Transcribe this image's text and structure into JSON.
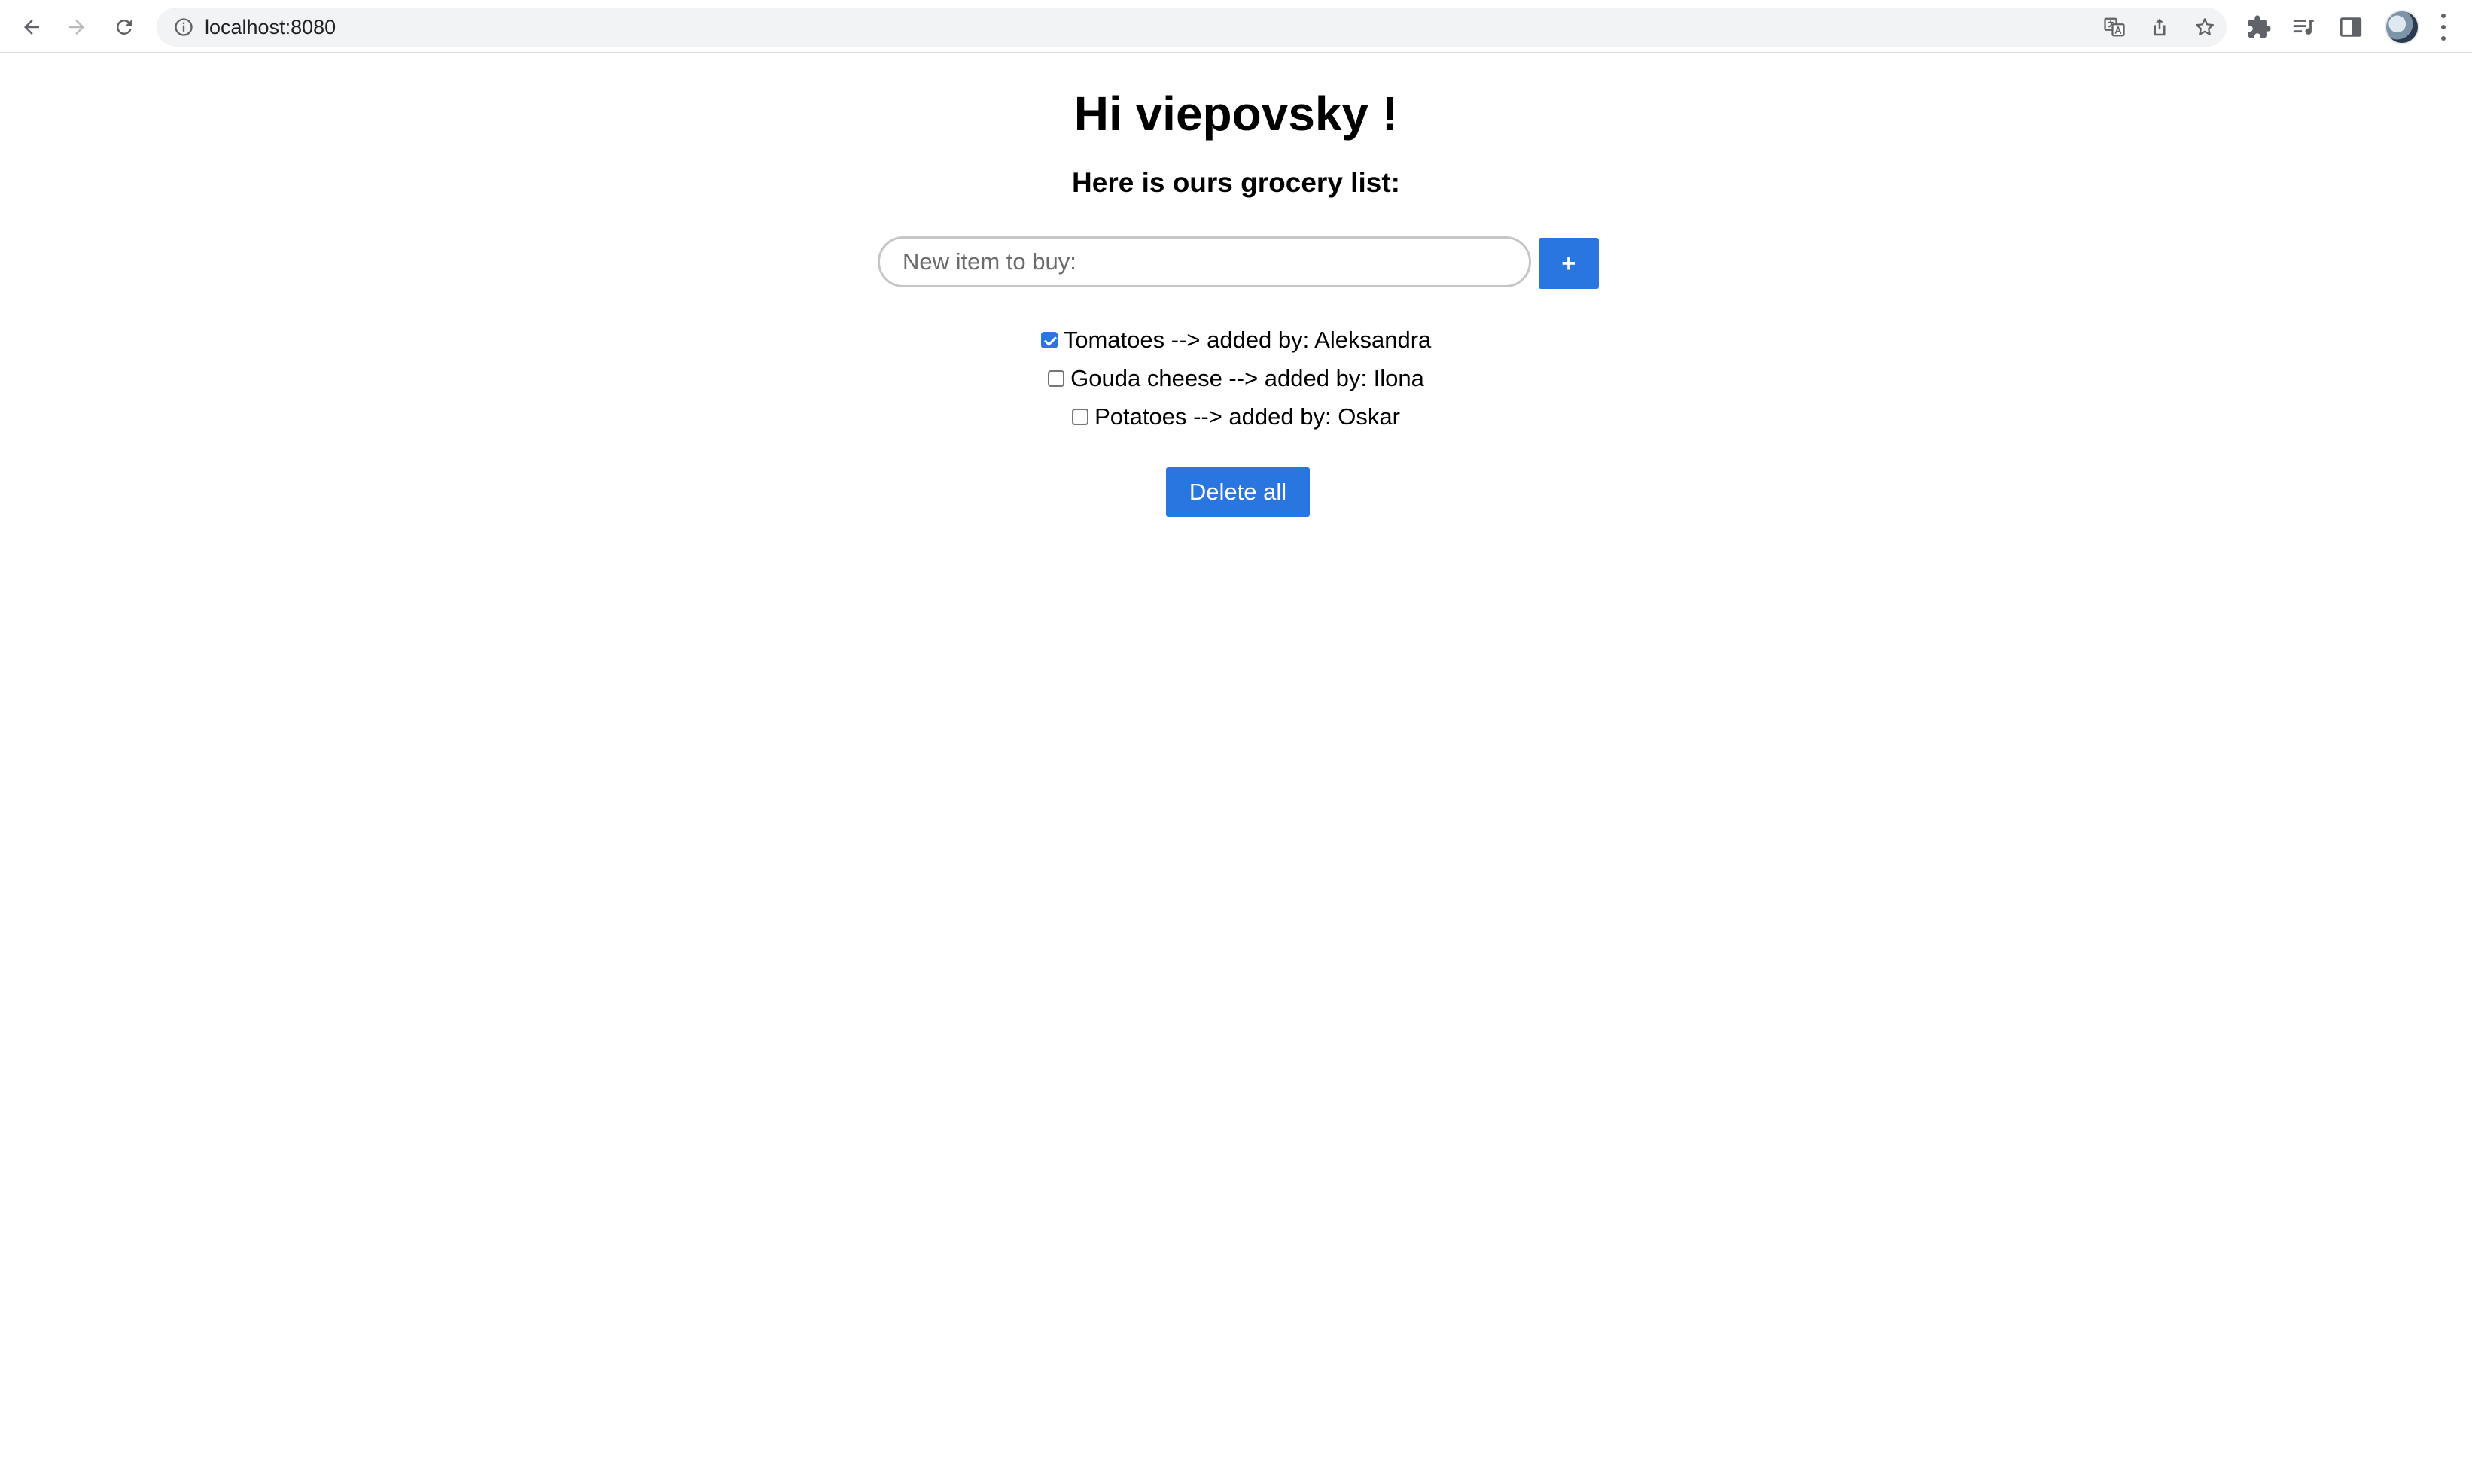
{
  "browser": {
    "url": "localhost:8080"
  },
  "page": {
    "greeting": "Hi viepovsky !",
    "subtitle": "Here is ours grocery list:",
    "new_item_placeholder": "New item to buy:",
    "add_button_label": "+",
    "delete_all_label": "Delete all",
    "accent_color": "#2a76e0",
    "items": [
      {
        "label": "Tomatoes --> added by: Aleksandra",
        "checked": true
      },
      {
        "label": "Gouda cheese --> added by: Ilona",
        "checked": false
      },
      {
        "label": "Potatoes --> added by: Oskar",
        "checked": false
      }
    ]
  }
}
